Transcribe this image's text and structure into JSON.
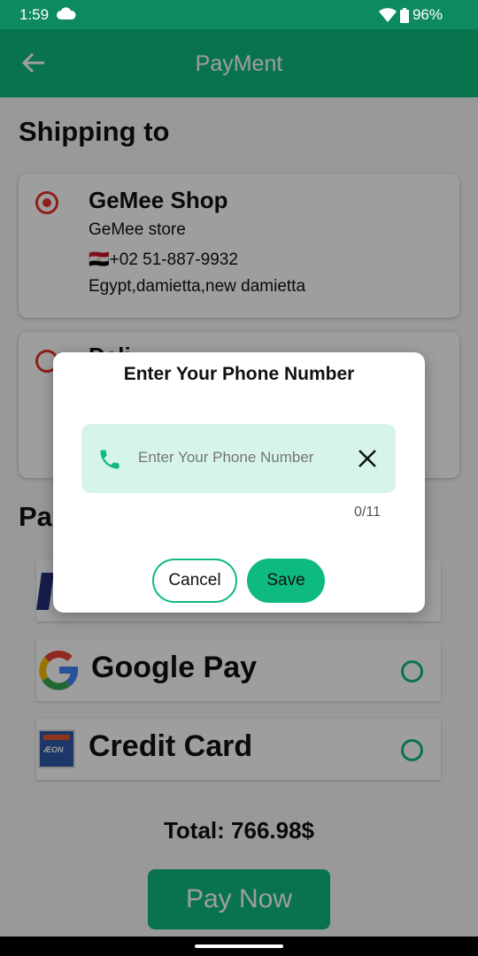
{
  "status_bar": {
    "time": "1:59",
    "battery": "96%"
  },
  "app_bar": {
    "title": "PayMent"
  },
  "shipping": {
    "heading": "Shipping to",
    "addresses": [
      {
        "name": "GeMee Shop",
        "line1": "GeMee store",
        "phone": "🇪🇬+02 51-887-9932",
        "address": "Egypt,damietta,new damietta",
        "selected": true
      },
      {
        "name": "Deli",
        "selected": false
      }
    ]
  },
  "payment": {
    "heading": "Pa",
    "methods": [
      {
        "label": "",
        "icon": "paypal-icon"
      },
      {
        "label": "Google Pay",
        "icon": "google-icon"
      },
      {
        "label": "Credit Card",
        "icon": "credit-card-icon"
      }
    ]
  },
  "total": "Total: 766.98$",
  "pay_button": "Pay Now",
  "dialog": {
    "title": "Enter Your Phone Number",
    "placeholder": "Enter Your Phone Number",
    "counter": "0/11",
    "cancel": "Cancel",
    "save": "Save"
  },
  "colors": {
    "primary": "#0fba7f",
    "status_bar": "#0e8a63",
    "radio_selected": "#e8312b",
    "field_bg": "#d6f5e8"
  }
}
